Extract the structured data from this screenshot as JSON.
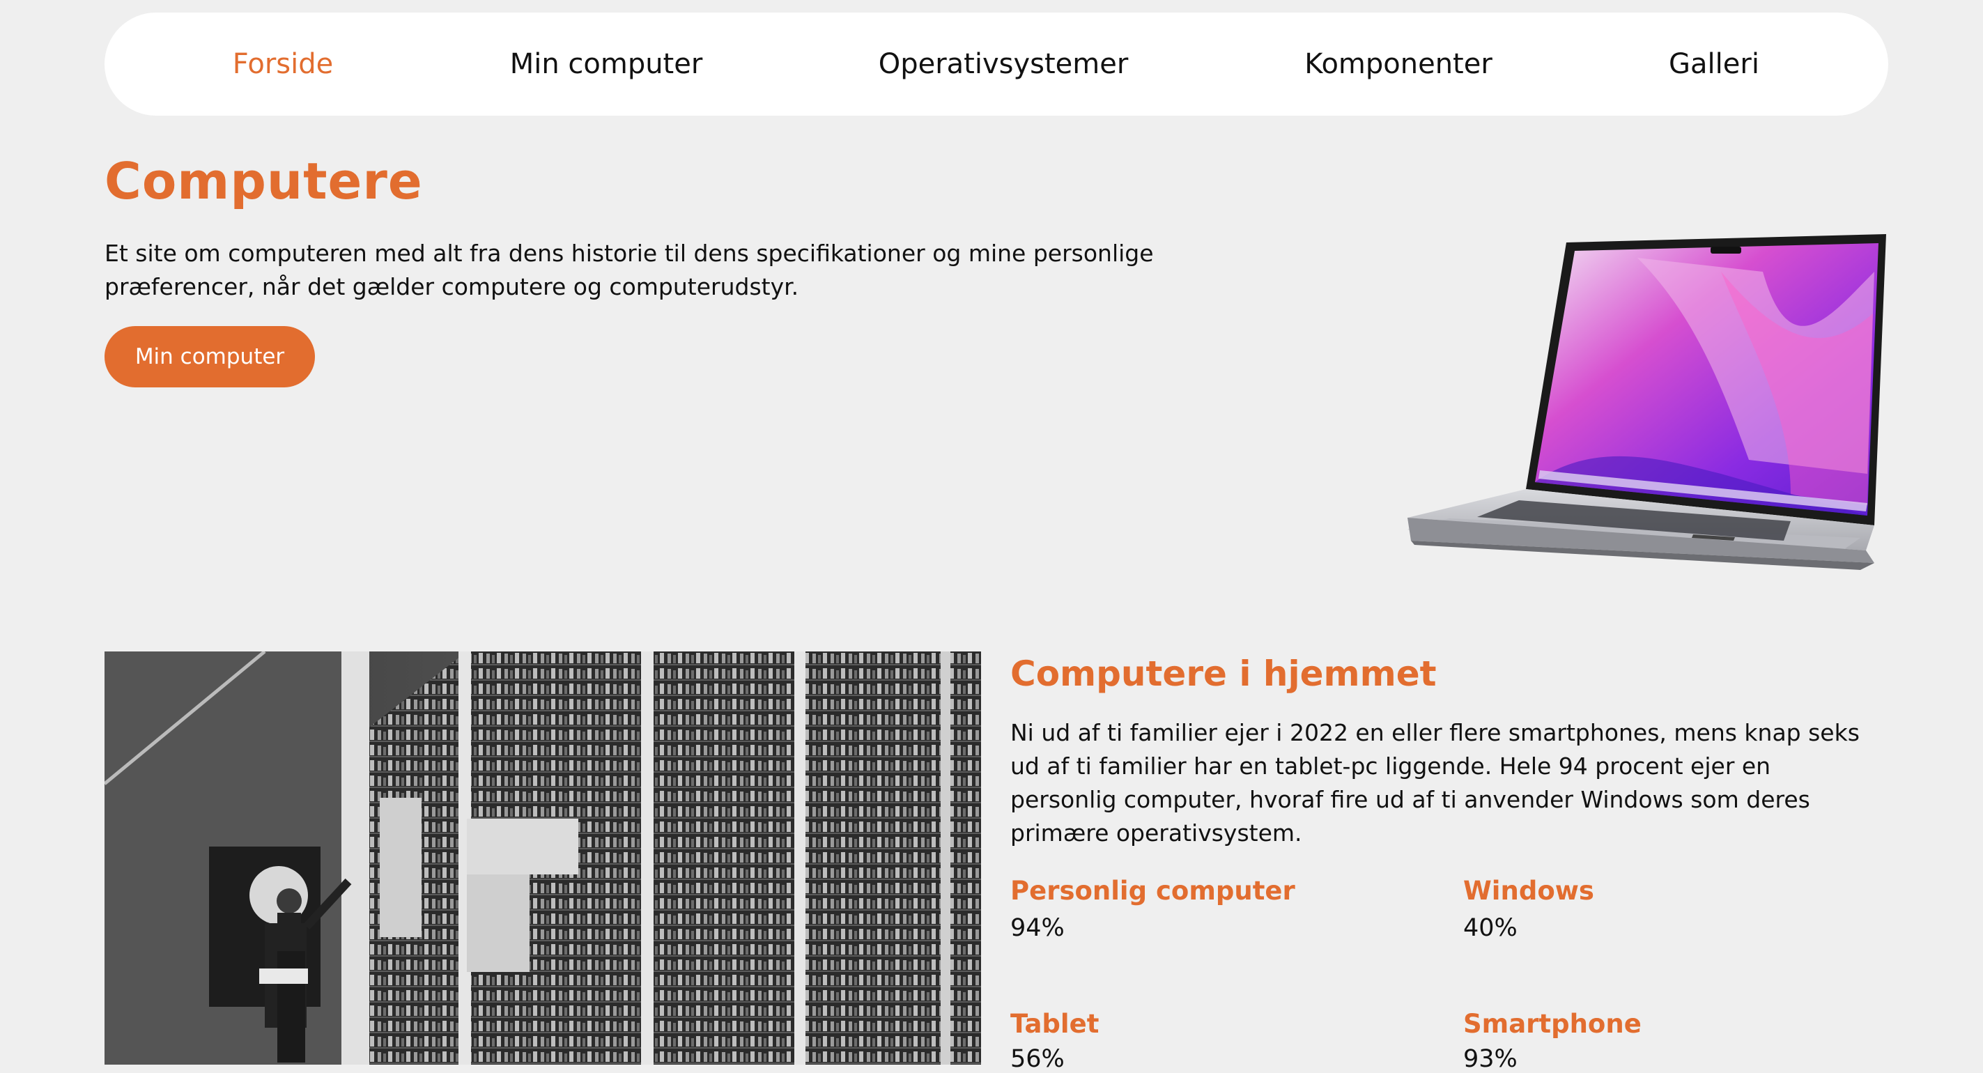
{
  "nav": {
    "items": [
      {
        "label": "Forside",
        "active": true
      },
      {
        "label": "Min computer",
        "active": false
      },
      {
        "label": "Operativsystemer",
        "active": false
      },
      {
        "label": "Komponenter",
        "active": false
      },
      {
        "label": "Galleri",
        "active": false
      }
    ]
  },
  "hero": {
    "title": "Computere",
    "text": "Et site om computeren med alt fra dens historie til dens specifikationer og mine personlige præferencer, når det gælder computere og computerudstyr.",
    "button_label": "Min computer"
  },
  "home_section": {
    "title": "Computere i hjemmet",
    "text": "Ni ud af ti familier ejer i 2022 en eller flere smartphones, mens knap seks ud af ti familier har en tablet-pc liggende. Hele 94 procent ejer en personlig computer, hvoraf fire ud af ti anvender Windows som deres primære operativsystem.",
    "stats": [
      {
        "label": "Personlig computer",
        "value": "94%"
      },
      {
        "label": "Windows",
        "value": "40%"
      },
      {
        "label": "Tablet",
        "value": "56%"
      },
      {
        "label": "Smartphone",
        "value": "93%"
      }
    ]
  },
  "colors": {
    "accent": "#e26d2f",
    "background": "#efefef",
    "nav_background": "#ffffff"
  },
  "images": {
    "hero": "laptop-image",
    "section": "vintage-mainframe-photo"
  }
}
